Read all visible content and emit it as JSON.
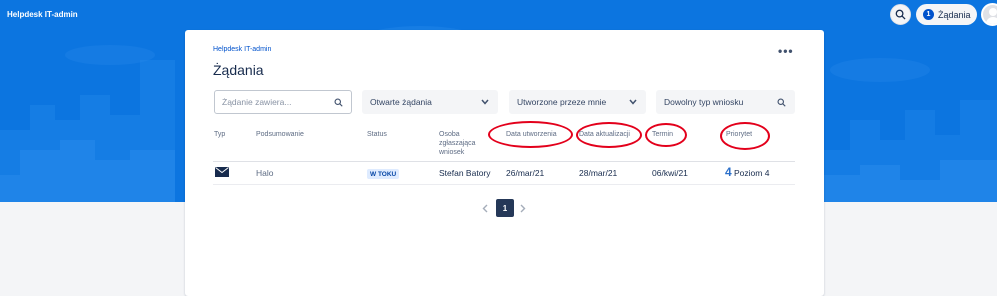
{
  "app": {
    "brand": "Helpdesk IT-admin"
  },
  "topbar": {
    "requests_count": "1",
    "requests_label": "Żądania"
  },
  "card": {
    "breadcrumb": "Helpdesk IT-admin",
    "title": "Żądania"
  },
  "filters": {
    "search_placeholder": "Żądanie zawiera...",
    "status_select": "Otwarte żądania",
    "created_by_select": "Utworzone przeze mnie",
    "type_search": "Dowolny typ wniosku"
  },
  "table": {
    "headers": {
      "type": "Typ",
      "summary": "Podsumowanie",
      "status": "Status",
      "reporter_line1": "Osoba",
      "reporter_line2": "zgłaszająca",
      "reporter_line3": "wniosek",
      "created": "Data utworzenia",
      "updated": "Data aktualizacji",
      "due": "Termin",
      "priority": "Priorytet"
    },
    "rows": [
      {
        "type_icon": "mail-icon",
        "summary": "Halo",
        "status": "W TOKU",
        "reporter": "Stefan Batory",
        "created": "26/mar/21",
        "updated": "28/mar/21",
        "due": "06/kwi/21",
        "priority_number": "4",
        "priority_label": "Poziom 4"
      }
    ]
  },
  "pagination": {
    "current_page": "1"
  },
  "colors": {
    "banner": "#0c75e0",
    "accent": "#0052cc",
    "annotation": "#e3001b",
    "status_bg": "#deebff"
  }
}
